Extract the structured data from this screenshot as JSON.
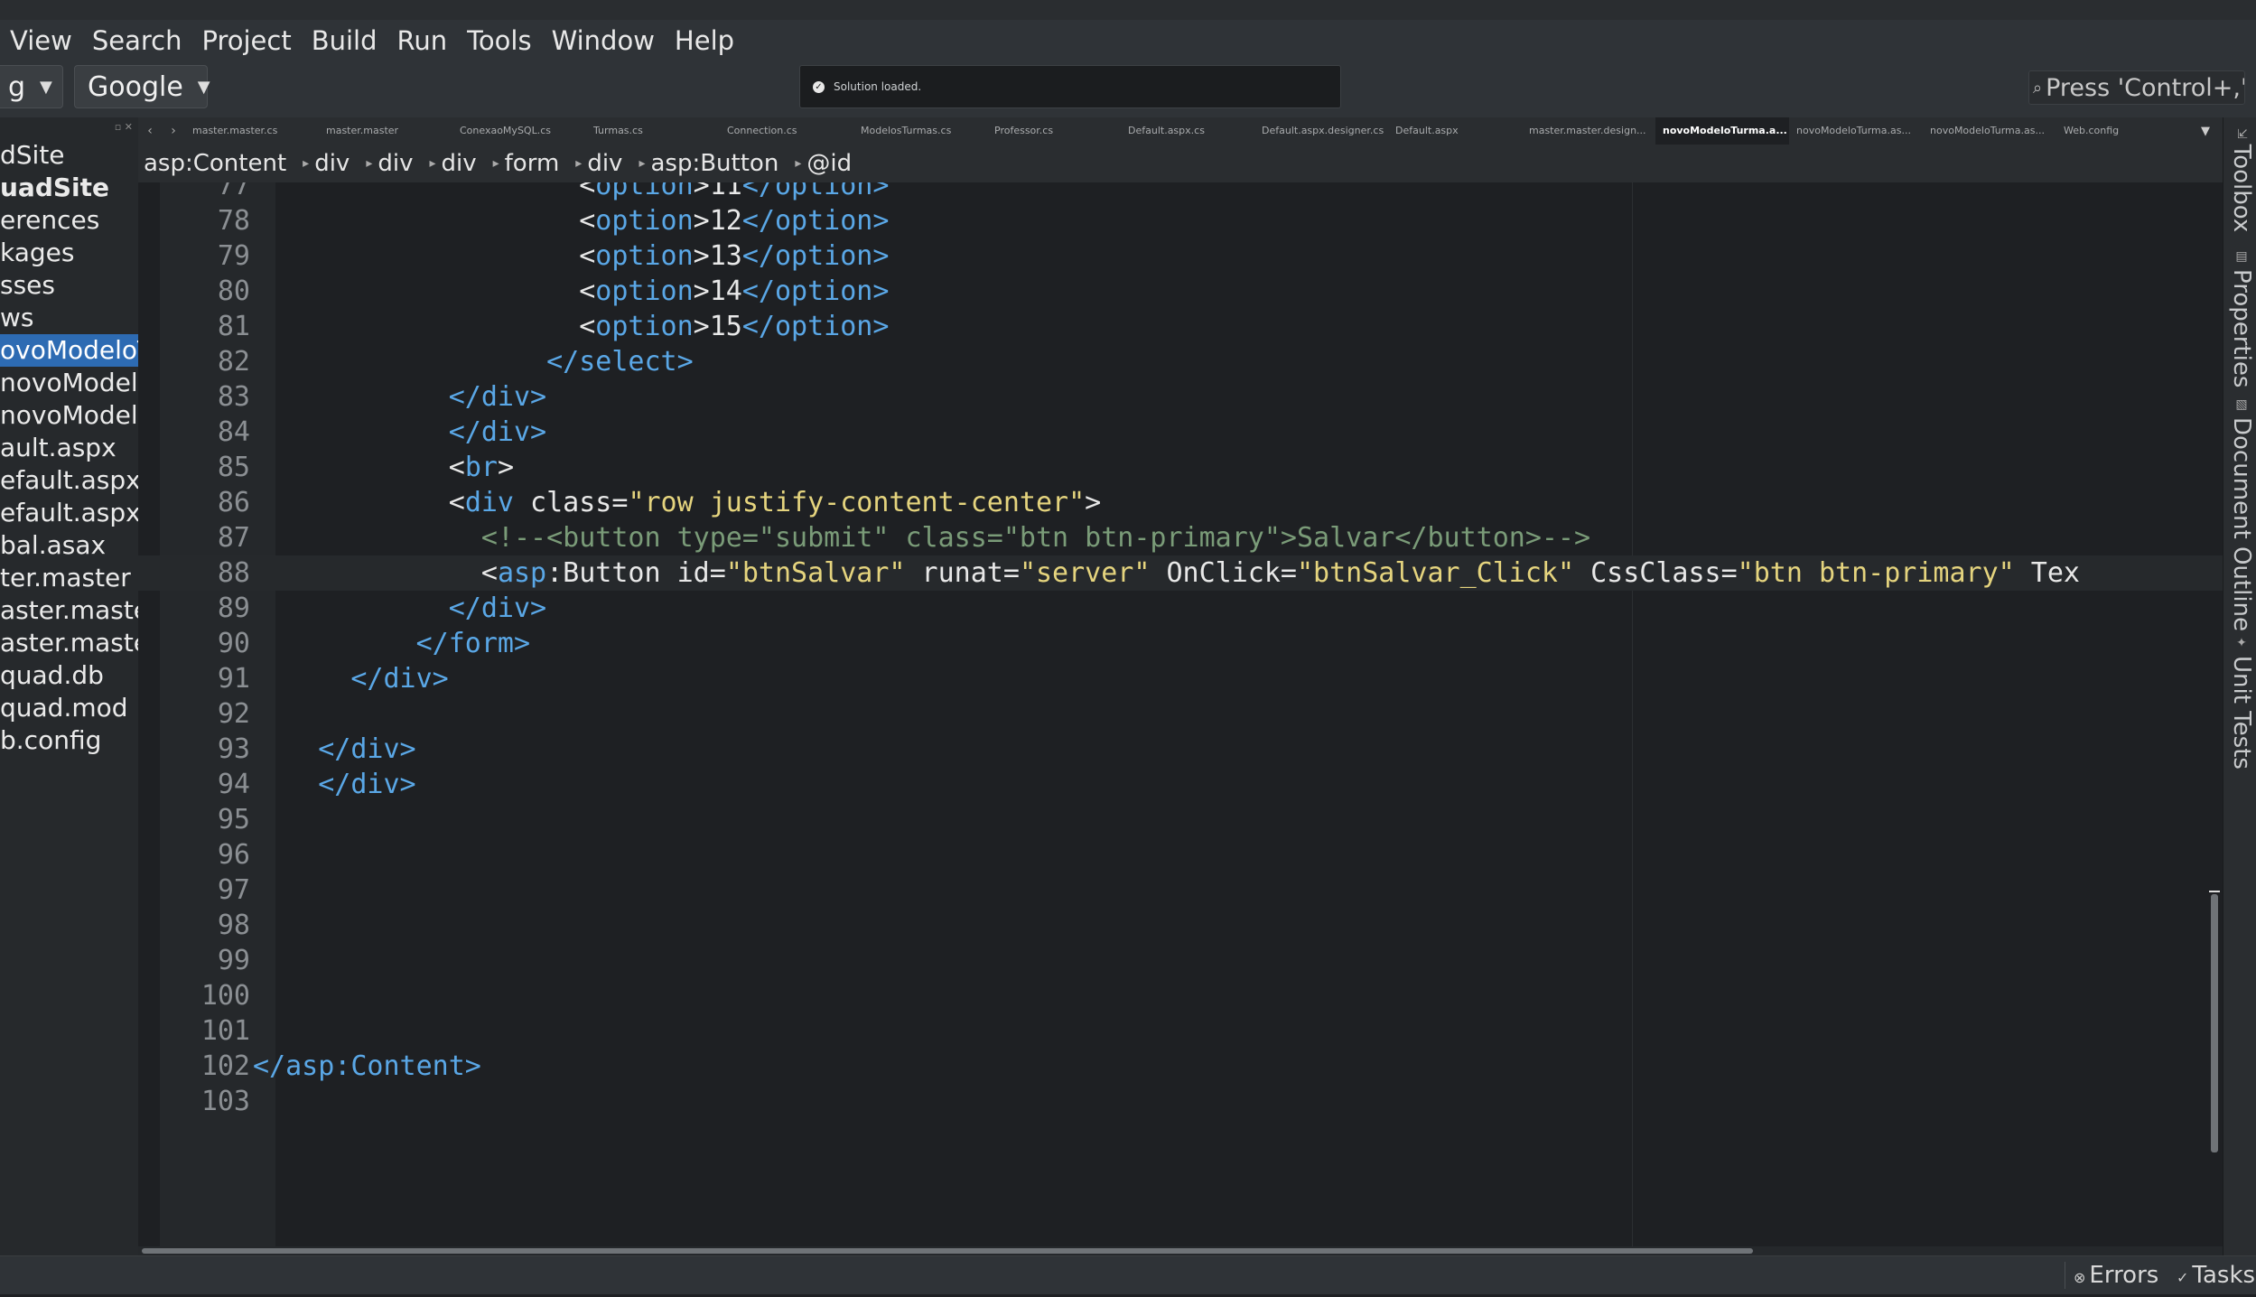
{
  "menu": {
    "items": [
      "View",
      "Search",
      "Project",
      "Build",
      "Run",
      "Tools",
      "Window",
      "Help"
    ]
  },
  "toolbar": {
    "config_combo": "g",
    "target_combo": "Google",
    "notification": "Solution loaded.",
    "search_placeholder": "Press 'Control+,' t"
  },
  "solution_tree": {
    "items": [
      {
        "label": "dSite",
        "style": "normal"
      },
      {
        "label": "uadSite",
        "style": "bold"
      },
      {
        "label": "erences",
        "style": "normal"
      },
      {
        "label": "kages",
        "style": "normal"
      },
      {
        "label": "sses",
        "style": "normal"
      },
      {
        "label": "ws",
        "style": "normal"
      },
      {
        "label": "ovoModeloT",
        "style": "selected"
      },
      {
        "label": "novoModelo",
        "style": "normal"
      },
      {
        "label": "novoModelo",
        "style": "normal"
      },
      {
        "label": "ault.aspx",
        "style": "normal"
      },
      {
        "label": "efault.aspx.c",
        "style": "normal"
      },
      {
        "label": "efault.aspx.c",
        "style": "normal"
      },
      {
        "label": "bal.asax",
        "style": "normal"
      },
      {
        "label": "ter.master",
        "style": "normal"
      },
      {
        "label": "aster.master",
        "style": "normal"
      },
      {
        "label": "aster.master",
        "style": "normal"
      },
      {
        "label": "quad.db",
        "style": "normal"
      },
      {
        "label": "quad.mod",
        "style": "normal"
      },
      {
        "label": "b.config",
        "style": "normal"
      }
    ]
  },
  "tabs": [
    {
      "label": "master.master.cs",
      "active": false
    },
    {
      "label": "master.master",
      "active": false
    },
    {
      "label": "ConexaoMySQL.cs",
      "active": false
    },
    {
      "label": "Turmas.cs",
      "active": false
    },
    {
      "label": "Connection.cs",
      "active": false
    },
    {
      "label": "ModelosTurmas.cs",
      "active": false
    },
    {
      "label": "Professor.cs",
      "active": false
    },
    {
      "label": "Default.aspx.cs",
      "active": false
    },
    {
      "label": "Default.aspx.designer.cs",
      "active": false
    },
    {
      "label": "Default.aspx",
      "active": false
    },
    {
      "label": "master.master.design...",
      "active": false
    },
    {
      "label": "novoModeloTurma.a...",
      "active": true
    },
    {
      "label": "novoModeloTurma.as...",
      "active": false
    },
    {
      "label": "novoModeloTurma.as...",
      "active": false
    },
    {
      "label": "Web.config",
      "active": false
    }
  ],
  "breadcrumb": [
    "asp:Content",
    "div",
    "div",
    "div",
    "form",
    "div",
    "asp:Button",
    "@id"
  ],
  "editor": {
    "current_line": "88",
    "lines": [
      {
        "n": "77",
        "tokens": [
          {
            "t": "                    ",
            "c": "text"
          },
          {
            "t": "<",
            "c": "punct"
          },
          {
            "t": "option",
            "c": "tag"
          },
          {
            "t": ">",
            "c": "punct"
          },
          {
            "t": "11",
            "c": "text"
          },
          {
            "t": "</option>",
            "c": "tag"
          }
        ]
      },
      {
        "n": "78",
        "tokens": [
          {
            "t": "                    ",
            "c": "text"
          },
          {
            "t": "<",
            "c": "punct"
          },
          {
            "t": "option",
            "c": "tag"
          },
          {
            "t": ">",
            "c": "punct"
          },
          {
            "t": "12",
            "c": "text"
          },
          {
            "t": "</option>",
            "c": "tag"
          }
        ]
      },
      {
        "n": "79",
        "tokens": [
          {
            "t": "                    ",
            "c": "text"
          },
          {
            "t": "<",
            "c": "punct"
          },
          {
            "t": "option",
            "c": "tag"
          },
          {
            "t": ">",
            "c": "punct"
          },
          {
            "t": "13",
            "c": "text"
          },
          {
            "t": "</option>",
            "c": "tag"
          }
        ]
      },
      {
        "n": "80",
        "tokens": [
          {
            "t": "                    ",
            "c": "text"
          },
          {
            "t": "<",
            "c": "punct"
          },
          {
            "t": "option",
            "c": "tag"
          },
          {
            "t": ">",
            "c": "punct"
          },
          {
            "t": "14",
            "c": "text"
          },
          {
            "t": "</option>",
            "c": "tag"
          }
        ]
      },
      {
        "n": "81",
        "tokens": [
          {
            "t": "                    ",
            "c": "text"
          },
          {
            "t": "<",
            "c": "punct"
          },
          {
            "t": "option",
            "c": "tag"
          },
          {
            "t": ">",
            "c": "punct"
          },
          {
            "t": "15",
            "c": "text"
          },
          {
            "t": "</option>",
            "c": "tag"
          }
        ]
      },
      {
        "n": "82",
        "tokens": [
          {
            "t": "                  ",
            "c": "text"
          },
          {
            "t": "</select>",
            "c": "tag"
          }
        ]
      },
      {
        "n": "83",
        "tokens": [
          {
            "t": "            ",
            "c": "text"
          },
          {
            "t": "</div>",
            "c": "tag"
          }
        ]
      },
      {
        "n": "84",
        "tokens": [
          {
            "t": "            ",
            "c": "text"
          },
          {
            "t": "</div>",
            "c": "tag"
          }
        ]
      },
      {
        "n": "85",
        "tokens": [
          {
            "t": "            ",
            "c": "text"
          },
          {
            "t": "<",
            "c": "punct"
          },
          {
            "t": "br",
            "c": "tag"
          },
          {
            "t": ">",
            "c": "punct"
          }
        ]
      },
      {
        "n": "86",
        "tokens": [
          {
            "t": "            ",
            "c": "text"
          },
          {
            "t": "<",
            "c": "punct"
          },
          {
            "t": "div",
            "c": "tag"
          },
          {
            "t": " class=",
            "c": "attr"
          },
          {
            "t": "\"row justify-content-center\"",
            "c": "str"
          },
          {
            "t": ">",
            "c": "punct"
          }
        ]
      },
      {
        "n": "87",
        "tokens": [
          {
            "t": "              ",
            "c": "text"
          },
          {
            "t": "<!--<button type=\"submit\" class=\"btn btn-primary\">Salvar</button>-->",
            "c": "cmt"
          }
        ]
      },
      {
        "n": "88",
        "tokens": [
          {
            "t": "              ",
            "c": "text"
          },
          {
            "t": "<",
            "c": "punct"
          },
          {
            "t": "asp",
            "c": "tag"
          },
          {
            "t": ":Button id=",
            "c": "attr"
          },
          {
            "t": "\"btnSalvar\"",
            "c": "str"
          },
          {
            "t": " runat=",
            "c": "attr"
          },
          {
            "t": "\"server\"",
            "c": "str"
          },
          {
            "t": " OnClick=",
            "c": "attr"
          },
          {
            "t": "\"btnSalvar_Click\"",
            "c": "str"
          },
          {
            "t": " CssClass=",
            "c": "attr"
          },
          {
            "t": "\"btn btn-primary\"",
            "c": "str"
          },
          {
            "t": " Tex",
            "c": "attr"
          }
        ]
      },
      {
        "n": "89",
        "tokens": [
          {
            "t": "            ",
            "c": "text"
          },
          {
            "t": "</div>",
            "c": "tag"
          }
        ]
      },
      {
        "n": "90",
        "tokens": [
          {
            "t": "          ",
            "c": "text"
          },
          {
            "t": "</form>",
            "c": "tag"
          }
        ]
      },
      {
        "n": "91",
        "tokens": [
          {
            "t": "      ",
            "c": "text"
          },
          {
            "t": "</div>",
            "c": "tag"
          }
        ]
      },
      {
        "n": "92",
        "tokens": []
      },
      {
        "n": "93",
        "tokens": [
          {
            "t": "    ",
            "c": "text"
          },
          {
            "t": "</div>",
            "c": "tag"
          }
        ]
      },
      {
        "n": "94",
        "tokens": [
          {
            "t": "    ",
            "c": "text"
          },
          {
            "t": "</div>",
            "c": "tag"
          }
        ]
      },
      {
        "n": "95",
        "tokens": []
      },
      {
        "n": "96",
        "tokens": []
      },
      {
        "n": "97",
        "tokens": []
      },
      {
        "n": "98",
        "tokens": []
      },
      {
        "n": "99",
        "tokens": []
      },
      {
        "n": "100",
        "tokens": []
      },
      {
        "n": "101",
        "tokens": []
      },
      {
        "n": "102",
        "tokens": [
          {
            "t": "</asp:Content>",
            "c": "tag"
          }
        ]
      },
      {
        "n": "103",
        "tokens": []
      }
    ]
  },
  "right_pads": [
    {
      "label": "Toolbox",
      "icon": "toolbox-icon"
    },
    {
      "label": "Properties",
      "icon": "properties-icon"
    },
    {
      "label": "Document Outline",
      "icon": "document-outline-icon"
    },
    {
      "label": "Unit Tests",
      "icon": "unit-tests-icon"
    }
  ],
  "statusbar": {
    "errors_label": "Errors",
    "tasks_label": "Tasks"
  }
}
